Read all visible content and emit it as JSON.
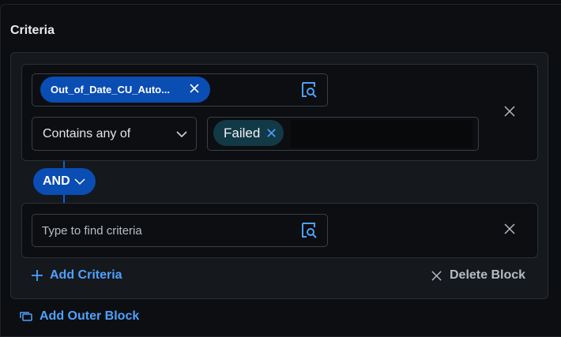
{
  "section": {
    "title": "Criteria"
  },
  "block1": {
    "criteria_chip": "Out_of_Date_CU_Auto...",
    "operator": "Contains any of",
    "value_chip": "Failed"
  },
  "connector": {
    "label": "AND"
  },
  "block2": {
    "placeholder": "Type to find criteria"
  },
  "actions": {
    "add_criteria": "Add Criteria",
    "delete_block": "Delete Block",
    "add_outer_block": "Add Outer Block"
  },
  "icons": {
    "criteria_search": "search-criteria-icon",
    "remove": "close-icon",
    "dropdown": "chevron-down-icon",
    "add": "plus-icon",
    "outer_block": "add-outer-block-icon"
  },
  "colors": {
    "accent": "#0a4db3",
    "link": "#4ea1ff",
    "value_chip": "#123946",
    "background": "#0c0e11"
  }
}
